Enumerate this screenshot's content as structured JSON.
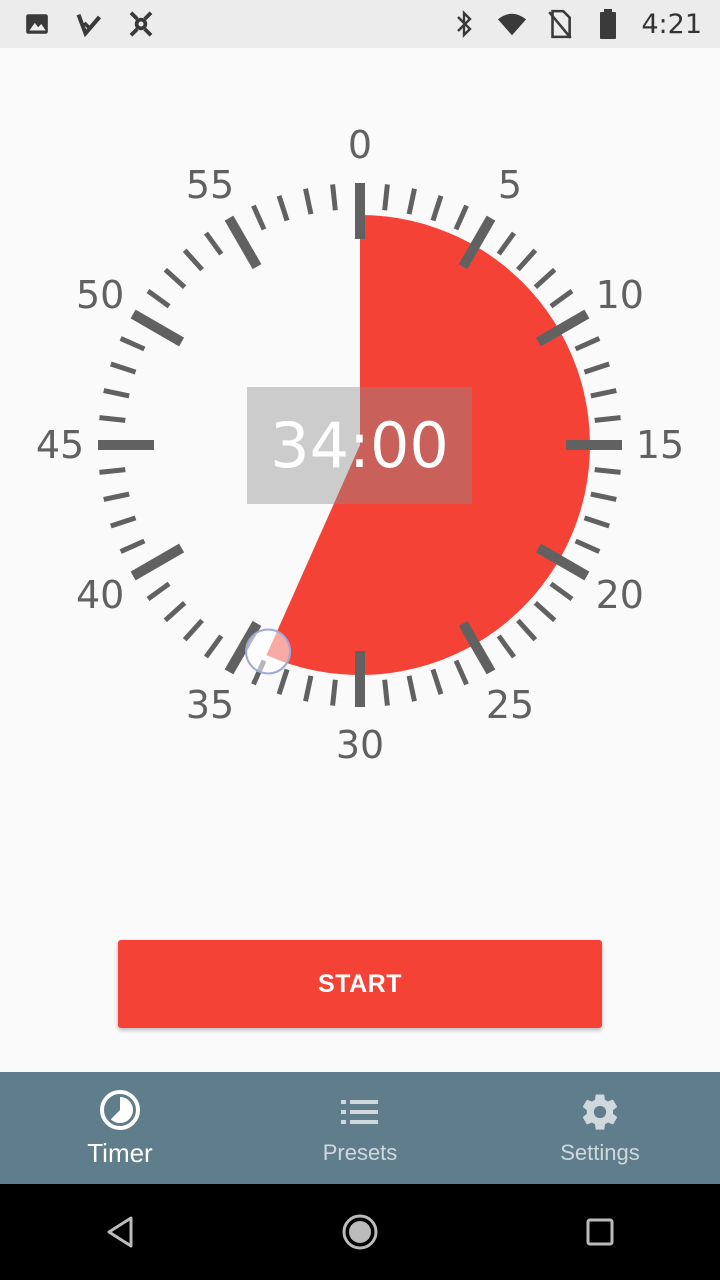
{
  "status_bar": {
    "time": "4:21",
    "left_icons": [
      "image-icon",
      "check-icon",
      "app-icon"
    ],
    "right_icons": [
      "bluetooth-icon",
      "wifi-icon",
      "no-sim-icon",
      "battery-icon"
    ]
  },
  "timer": {
    "display": "34:00",
    "set_minutes": 34,
    "dial_labels": [
      "0",
      "5",
      "10",
      "15",
      "20",
      "25",
      "30",
      "35",
      "40",
      "45",
      "50",
      "55"
    ],
    "accent_color": "#f44336"
  },
  "start_button": {
    "label": "START"
  },
  "bottom_nav": {
    "items": [
      {
        "label": "Timer",
        "icon": "clock-icon",
        "active": true
      },
      {
        "label": "Presets",
        "icon": "list-icon",
        "active": false
      },
      {
        "label": "Settings",
        "icon": "gear-icon",
        "active": false
      }
    ],
    "background": "#607d8b"
  },
  "system_nav": {
    "buttons": [
      "back-icon",
      "home-icon",
      "recents-icon"
    ]
  }
}
